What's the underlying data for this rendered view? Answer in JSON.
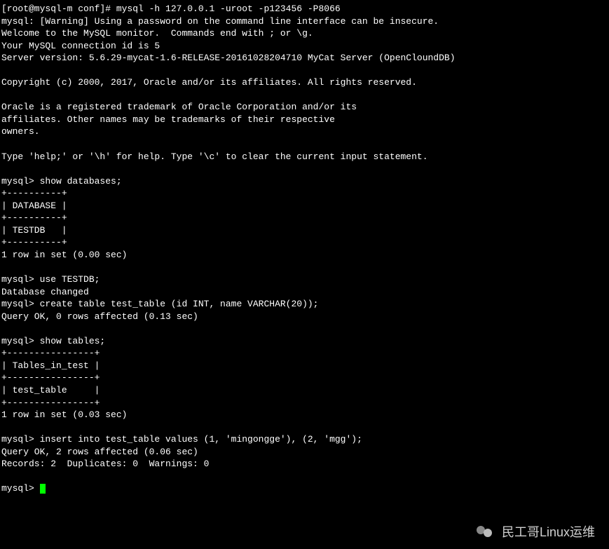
{
  "prompt": "[root@mysql-m conf]# ",
  "cmd1": "mysql -h 127.0.0.1 -uroot -p123456 -P8066",
  "banner": {
    "l1": "mysql: [Warning] Using a password on the command line interface can be insecure.",
    "l2": "Welcome to the MySQL monitor.  Commands end with ; or \\g.",
    "l3": "Your MySQL connection id is 5",
    "l4": "Server version: 5.6.29-mycat-1.6-RELEASE-20161028204710 MyCat Server (OpenCloundDB)",
    "l5": "Copyright (c) 2000, 2017, Oracle and/or its affiliates. All rights reserved.",
    "l6": "Oracle is a registered trademark of Oracle Corporation and/or its",
    "l7": "affiliates. Other names may be trademarks of their respective",
    "l8": "owners.",
    "l9": "Type 'help;' or '\\h' for help. Type '\\c' to clear the current input statement."
  },
  "mysql_prompt": "mysql> ",
  "q1": "show databases;",
  "r1": {
    "sep": "+----------+",
    "head": "| DATABASE |",
    "row": "| TESTDB   |",
    "sum": "1 row in set (0.00 sec)"
  },
  "q2": "use TESTDB;",
  "r2": "Database changed",
  "q3": "create table test_table (id INT, name VARCHAR(20));",
  "r3": "Query OK, 0 rows affected (0.13 sec)",
  "q4": "show tables;",
  "r4": {
    "sep": "+----------------+",
    "head": "| Tables_in_test |",
    "row": "| test_table     |",
    "sum": "1 row in set (0.03 sec)"
  },
  "q5": "insert into test_table values (1, 'mingongge'), (2, 'mgg');",
  "r5a": "Query OK, 2 rows affected (0.06 sec)",
  "r5b": "Records: 2  Duplicates: 0  Warnings: 0",
  "watermark": "民工哥Linux运维"
}
